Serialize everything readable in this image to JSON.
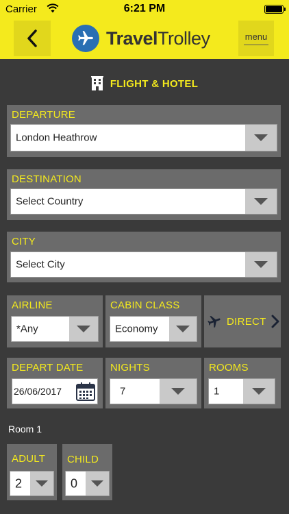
{
  "status_bar": {
    "carrier": "Carrier",
    "time": "6:21 PM"
  },
  "header": {
    "logo_bold": "Travel",
    "logo_light": "Trolley",
    "menu_label": "menu"
  },
  "section": {
    "title": "FLIGHT & HOTEL"
  },
  "form": {
    "departure": {
      "label": "DEPARTURE",
      "value": "London Heathrow"
    },
    "destination": {
      "label": "DESTINATION",
      "value": "Select Country"
    },
    "city": {
      "label": "CITY",
      "value": "Select City"
    },
    "airline": {
      "label": "AIRLINE",
      "value": "*Any"
    },
    "cabin_class": {
      "label": "CABIN CLASS",
      "value": "Economy"
    },
    "direct": {
      "label": "DIRECT"
    },
    "depart_date": {
      "label": "DEPART DATE",
      "value": "26/06/2017"
    },
    "nights": {
      "label": "NIGHTS",
      "value": "7"
    },
    "rooms": {
      "label": "ROOMS",
      "value": "1"
    },
    "room1": {
      "label": "Room 1",
      "adult": {
        "label": "ADULT",
        "value": "2"
      },
      "child": {
        "label": "CHILD",
        "value": "0"
      }
    }
  },
  "colors": {
    "brand_yellow": "#f4ea1d",
    "background": "#3a3a3a",
    "panel": "#6b6b6b",
    "logo_blue": "#2a6fb3"
  },
  "icons": [
    "wifi-icon",
    "battery-icon",
    "back-chevron-icon",
    "plane-logo-icon",
    "hotel-icon",
    "calendar-icon",
    "plane-icon",
    "chevron-right-icon",
    "chevron-down-icon"
  ]
}
